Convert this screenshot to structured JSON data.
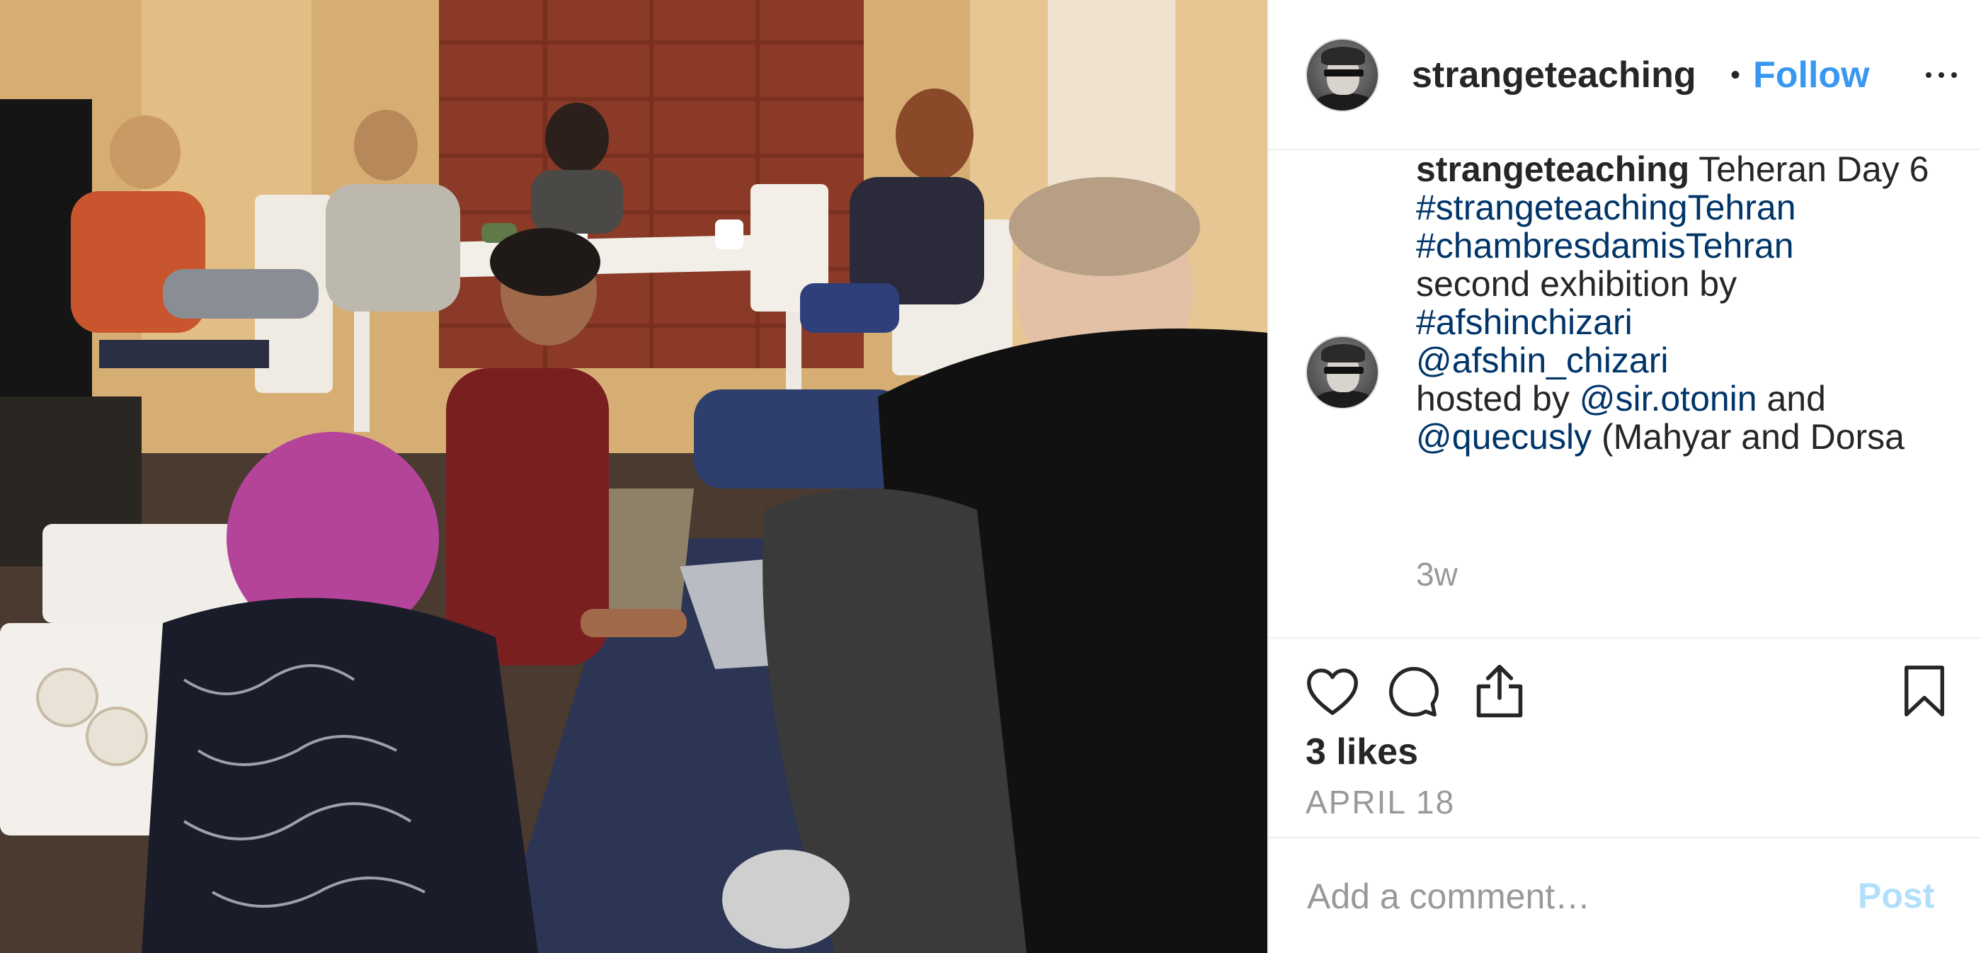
{
  "post": {
    "username": "strangeteaching",
    "follow_label": "Follow",
    "separator": "•",
    "more_icon": "more-horizontal-icon",
    "caption": {
      "username": "strangeteaching",
      "text_1": " Teheran Day 6 ",
      "tag_1": "#strangeteachingTehran",
      "tag_2": "#chambresdamisTehran",
      "text_2": " second exhibition by ",
      "tag_3": "#afshinchizari",
      "mention_1": "@afshin_chizari",
      "text_3": " hosted by ",
      "mention_2": "@sir.otonin",
      "text_4": " and ",
      "mention_3": "@quecusly",
      "text_5": " (Mahyar and Dorsa"
    },
    "time_ago": "3w",
    "likes": "3 likes",
    "date": "APRIL 18",
    "comment_placeholder": "Add a comment…",
    "post_label": "Post"
  },
  "icons": {
    "like": "heart-icon",
    "comment": "comment-bubble-icon",
    "share": "share-icon",
    "save": "bookmark-icon"
  },
  "colors": {
    "link": "#003569",
    "follow": "#3897f0",
    "muted": "#999999",
    "post_disabled": "#b2dffc"
  }
}
